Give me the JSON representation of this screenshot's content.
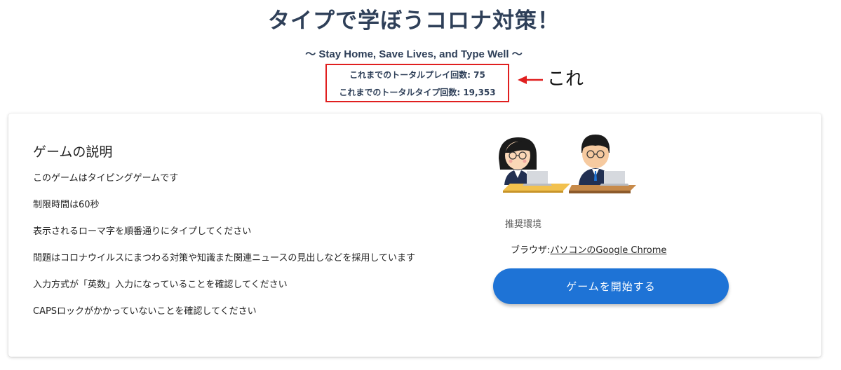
{
  "header": {
    "title": "タイプで学ぼうコロナ対策！",
    "subtitle": "〜 Stay Home, Save Lives, and Type Well 〜"
  },
  "stats": {
    "total_play": "これまでのトータルプレイ回数: 75",
    "total_type": "これまでのトータルタイプ回数: 19,353"
  },
  "annotation": {
    "text": "これ",
    "color": "#e01f1f"
  },
  "card": {
    "title": "ゲームの説明",
    "description": [
      "このゲームはタイピングゲームです",
      "制限時間は60秒",
      "表示されるローマ字を順番通りにタイプしてください",
      "問題はコロナウイルスにまつわる対策や知識また関連ニュースの見出しなどを採用しています",
      "入力方式が「英数」入力になっていることを確認してください",
      "CAPSロックがかかっていないことを確認してください"
    ],
    "env_label": "推奨環境",
    "browser_prefix": "ブラウザ:",
    "browser_link": "パソコンのGoogle Chrome",
    "start_button": "ゲームを開始する"
  },
  "colors": {
    "title": "#2e3f58",
    "highlight_border": "#e01f1f",
    "button": "#1e73d6"
  },
  "icons": [
    "arrow-left-icon",
    "people-at-laptops-illustration"
  ]
}
